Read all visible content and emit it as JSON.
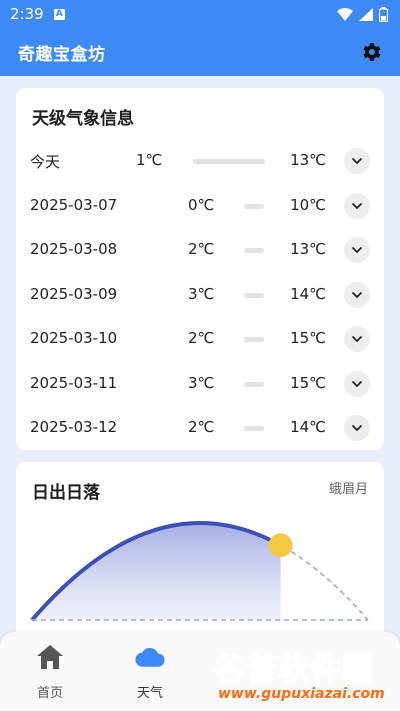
{
  "status_bar": {
    "time": "2:39",
    "notification_glyph": "A"
  },
  "app_bar": {
    "title": "奇趣宝盒坊"
  },
  "forecast": {
    "title": "天级气象信息",
    "days": [
      {
        "label": "今天",
        "low": "1℃",
        "high": "13℃"
      },
      {
        "label": "2025-03-07",
        "low": "0℃",
        "high": "10℃"
      },
      {
        "label": "2025-03-08",
        "low": "2℃",
        "high": "13℃"
      },
      {
        "label": "2025-03-09",
        "low": "3℃",
        "high": "14℃"
      },
      {
        "label": "2025-03-10",
        "low": "2℃",
        "high": "15℃"
      },
      {
        "label": "2025-03-11",
        "low": "3℃",
        "high": "15℃"
      },
      {
        "label": "2025-03-12",
        "low": "2℃",
        "high": "14℃"
      }
    ]
  },
  "sun": {
    "title": "日出日落",
    "moon_phase": "蛾眉月",
    "day_progress": 0.74
  },
  "nav": {
    "items": [
      {
        "label": "首页",
        "icon": "home-icon"
      },
      {
        "label": "天气",
        "icon": "cloud-icon"
      }
    ]
  },
  "watermark": {
    "title": "谷普软件园",
    "url": "www.gupuxiazai.com"
  },
  "colors": {
    "primary": "#3d89f6",
    "arc": "#3e4fb5",
    "sun": "#f4c842",
    "watermark": "#ff6a10"
  }
}
